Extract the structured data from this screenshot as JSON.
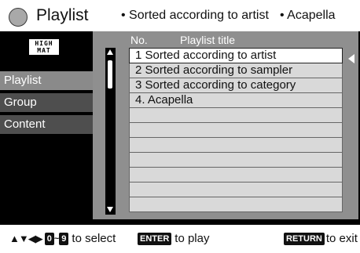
{
  "header": {
    "title": "Playlist",
    "info_sorted": "• Sorted according to artist",
    "info_title": "• Acapella"
  },
  "logo": {
    "line1": "HIGH",
    "line2": "MAT"
  },
  "sidebar": {
    "items": [
      {
        "label": "Playlist"
      },
      {
        "label": "Group"
      },
      {
        "label": "Content"
      }
    ]
  },
  "list": {
    "col_no": "No.",
    "col_title": "Playlist title",
    "rows": [
      "1  Sorted according to artist",
      "2  Sorted according to sampler",
      "3  Sorted according to category",
      "4.  Acapella",
      "",
      "",
      "",
      "",
      "",
      "",
      ""
    ]
  },
  "footer": {
    "arrows": "▲▼◀▶",
    "key_0": "0",
    "tilde": "~",
    "key_9": "9",
    "select_text": "to select",
    "enter_key": "ENTER",
    "play_text": "to play",
    "return_key": "RETURN",
    "exit_text": "to exit"
  }
}
